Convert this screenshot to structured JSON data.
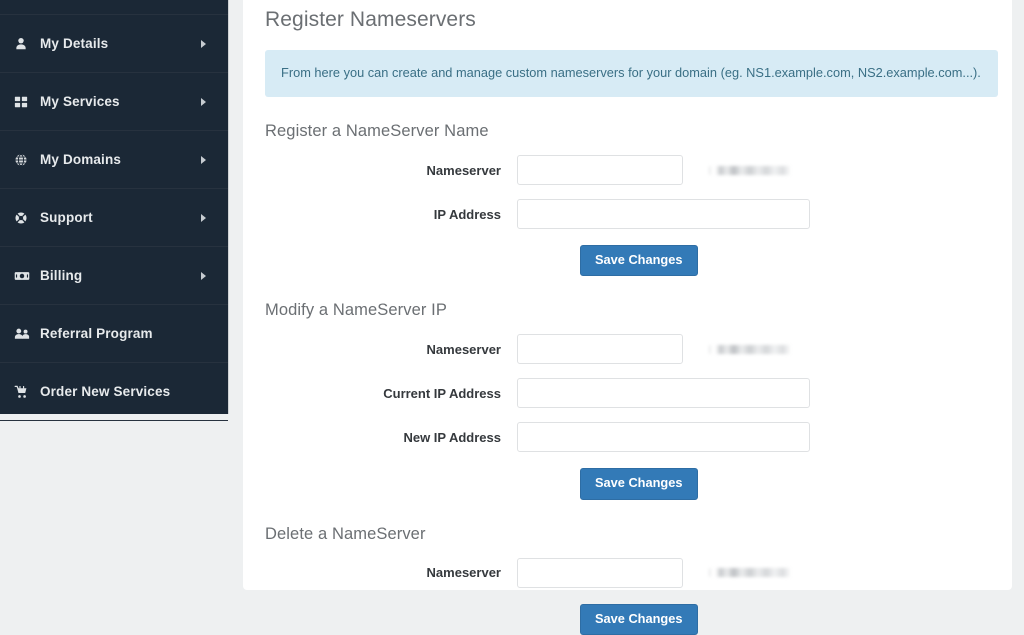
{
  "sidebar": {
    "items": [
      {
        "label": "",
        "icon": "partial-row-icon",
        "caret": false,
        "partial": true
      },
      {
        "label": "My Details",
        "icon": "user-icon",
        "caret": true,
        "partial": false
      },
      {
        "label": "My Services",
        "icon": "grid-icon",
        "caret": true,
        "partial": false
      },
      {
        "label": "My Domains",
        "icon": "globe-icon",
        "caret": true,
        "partial": false
      },
      {
        "label": "Support",
        "icon": "life-ring-icon",
        "caret": true,
        "partial": false
      },
      {
        "label": "Billing",
        "icon": "money-icon",
        "caret": true,
        "partial": false
      },
      {
        "label": "Referral Program",
        "icon": "users-icon",
        "caret": false,
        "partial": false
      },
      {
        "label": "Order New Services",
        "icon": "shopping-cart-icon",
        "caret": false,
        "partial": false
      }
    ]
  },
  "main": {
    "page_title": "Register Nameservers",
    "alert": "From here you can create and manage custom nameservers for your domain (eg. NS1.example.com, NS2.example.com...).",
    "sections": [
      {
        "title": "Register a NameServer Name",
        "fields": [
          {
            "label": "Nameserver",
            "value": "",
            "placeholder": "",
            "width": "narrow",
            "redacted_suffix": true
          },
          {
            "label": "IP Address",
            "value": "",
            "placeholder": "",
            "width": "wide",
            "redacted_suffix": false
          }
        ],
        "button": "Save Changes"
      },
      {
        "title": "Modify a NameServer IP",
        "fields": [
          {
            "label": "Nameserver",
            "value": "",
            "placeholder": "",
            "width": "narrow",
            "redacted_suffix": true
          },
          {
            "label": "Current IP Address",
            "value": "",
            "placeholder": "",
            "width": "wide",
            "redacted_suffix": false
          },
          {
            "label": "New IP Address",
            "value": "",
            "placeholder": "",
            "width": "wide",
            "redacted_suffix": false
          }
        ],
        "button": "Save Changes"
      },
      {
        "title": "Delete a NameServer",
        "fields": [
          {
            "label": "Nameserver",
            "value": "",
            "placeholder": "",
            "width": "narrow",
            "redacted_suffix": true
          }
        ],
        "button": "Save Changes"
      }
    ]
  },
  "colors": {
    "sidebar_bg": "#1b2836",
    "page_bg": "#eef0f1",
    "panel_bg": "#ffffff",
    "alert_bg": "#d7ebf5",
    "alert_text": "#3a6f85",
    "primary_button": "#337ab7",
    "primary_button_border": "#2e6da4",
    "heading_text": "#6b6f73",
    "label_text": "#35393d",
    "input_border": "#dfe1e3"
  }
}
